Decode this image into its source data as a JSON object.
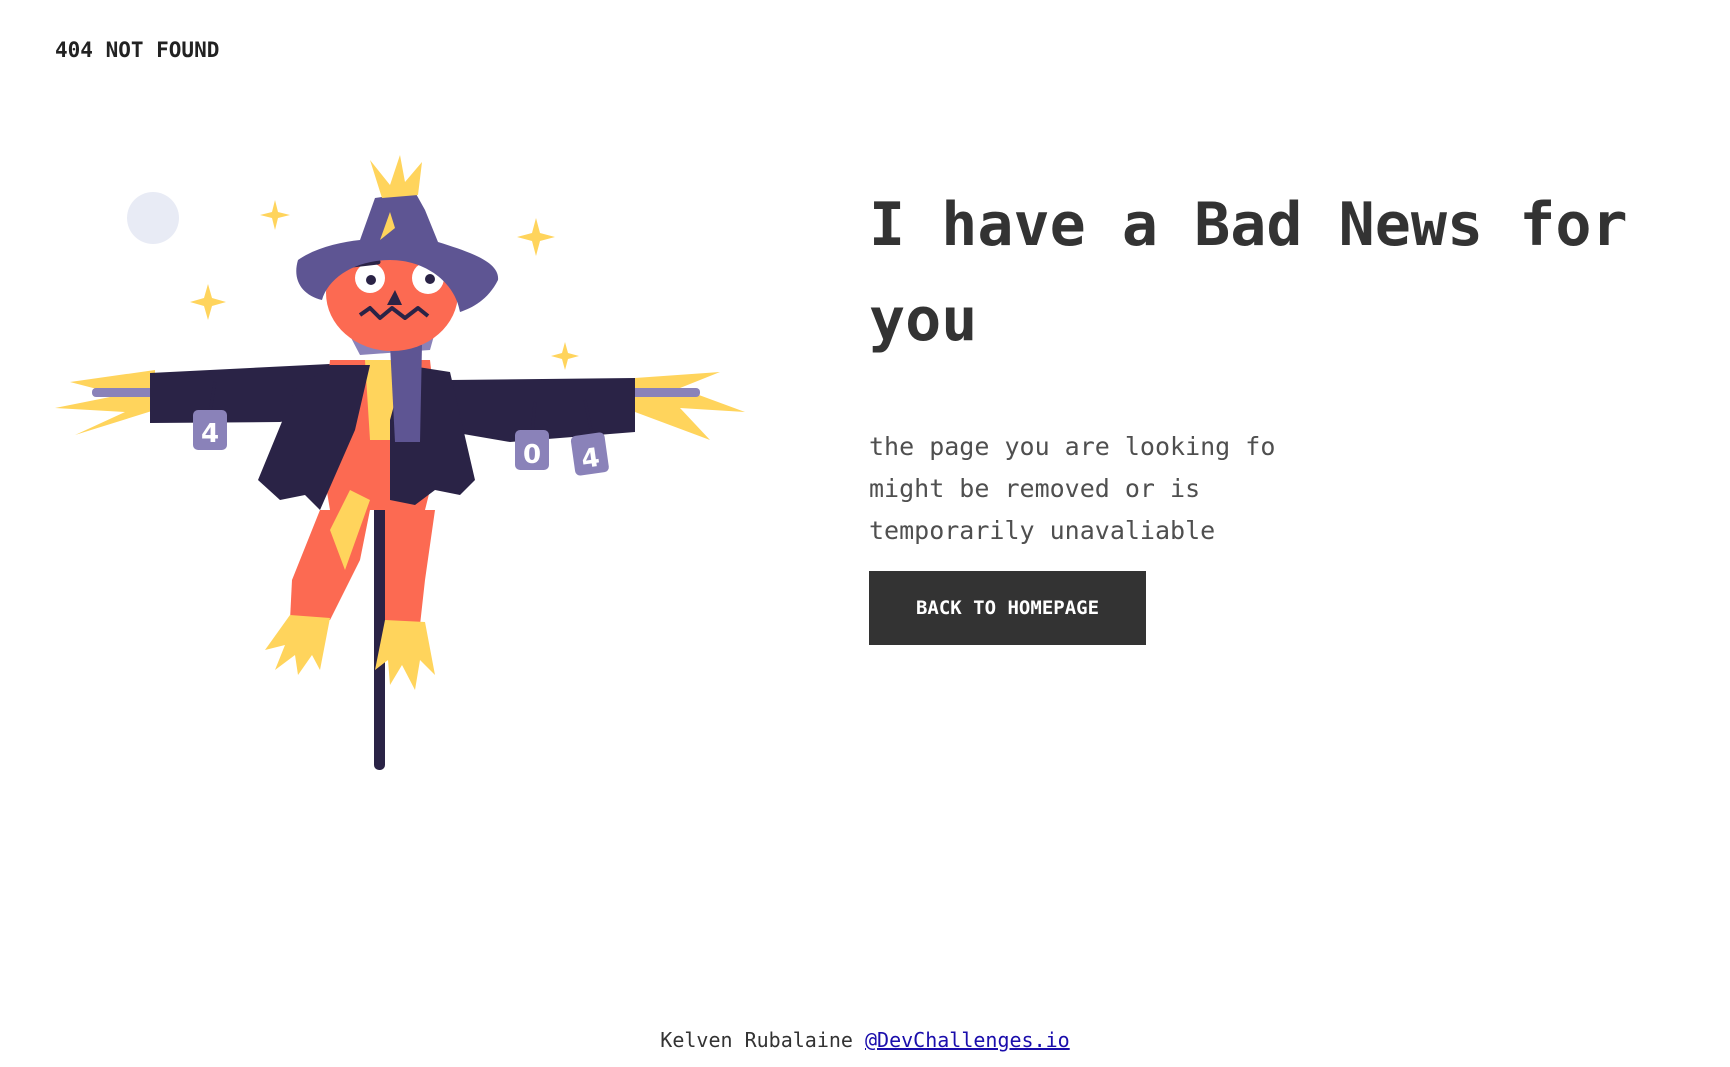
{
  "brand": {
    "title": "404 NOT FOUND"
  },
  "main": {
    "headline": "I have a Bad News for you",
    "message_lines": [
      "the page you are looking fo",
      "might be removed or is",
      "temporarily unavaliable"
    ],
    "button_label": "BACK TO HOMEPAGE"
  },
  "illustration": {
    "name": "scarecrow",
    "cans": [
      "4",
      "0",
      "4"
    ],
    "colors": {
      "hat": "#5e5593",
      "coat": "#2a2346",
      "face": "#fc6a52",
      "straw": "#ffd45c",
      "can": "#8a82b9",
      "moon": "#e8ebf5"
    }
  },
  "footer": {
    "author": "Kelven Rubalaine",
    "link_text": "@DevChallenges.io"
  },
  "colors": {
    "text": "#333333",
    "button_bg": "#333333",
    "button_text": "#ffffff",
    "link": "#1a0dab"
  }
}
